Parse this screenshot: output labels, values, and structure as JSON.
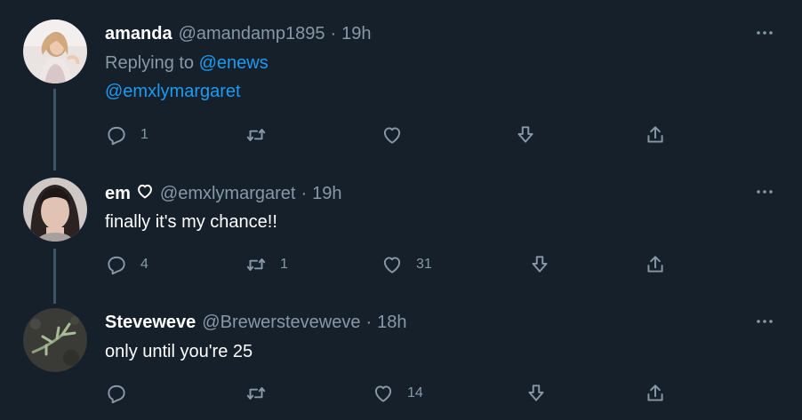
{
  "tweets": [
    {
      "name": "amanda",
      "handle": "@amandamp1895",
      "dot": "·",
      "time": "19h",
      "replying_prefix": "Replying to",
      "replying_to_1": "@enews",
      "replying_to_2": "@emxlymargaret",
      "actions": {
        "reply_count": "1",
        "retweet_count": "",
        "like_count": ""
      }
    },
    {
      "name": "em",
      "name_emoji": "heart-outline-icon",
      "handle": "@emxlymargaret",
      "dot": "·",
      "time": "19h",
      "text": "finally it's my chance!!",
      "actions": {
        "reply_count": "4",
        "retweet_count": "1",
        "like_count": "31"
      }
    },
    {
      "name": "Steveweve",
      "handle": "@Brewersteveweve",
      "dot": "·",
      "time": "18h",
      "text": "only until you're 25",
      "actions": {
        "reply_count": "",
        "retweet_count": "",
        "like_count": "14"
      }
    }
  ],
  "icons": {
    "reply": "reply-icon",
    "retweet": "retweet-icon",
    "like": "like-icon",
    "save": "bookmark-download-icon",
    "share": "share-icon",
    "more": "more-icon"
  },
  "colors": {
    "background": "#15202b",
    "text": "#ffffff",
    "secondary": "#8899a6",
    "link": "#1d9bf0",
    "thread_line": "#3d5466"
  }
}
